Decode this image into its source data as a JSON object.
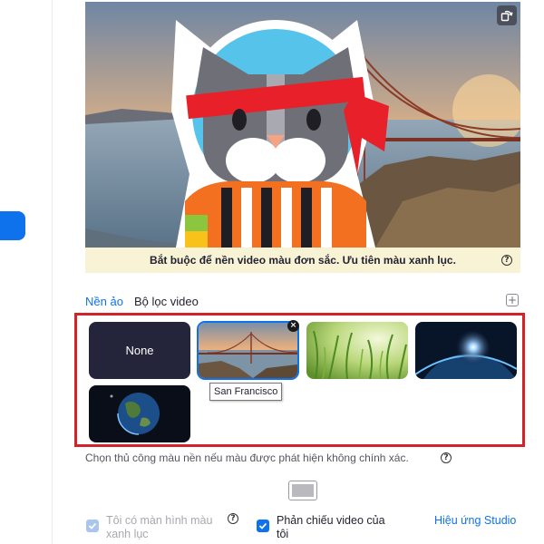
{
  "preview": {
    "notice": "Bắt buộc để nền video màu đơn sắc. Ưu tiên màu xanh lục."
  },
  "tabs": [
    {
      "label": "Nền ảo",
      "active": true
    },
    {
      "label": "Bộ lọc video",
      "active": false
    }
  ],
  "backgrounds": [
    {
      "label": "None"
    },
    {
      "tooltip": "San Francisco",
      "selected": true
    },
    {
      "name": "grass"
    },
    {
      "name": "earth-space"
    },
    {
      "name": "earth"
    }
  ],
  "manual_color": {
    "text": "Chọn thủ công màu nền nếu màu được phát hiện không chính xác."
  },
  "options": {
    "green_screen_label": "Tôi có màn hình màu xanh lục",
    "green_screen_checked": true,
    "green_screen_disabled": true,
    "mirror_label": "Phản chiếu video của tôi",
    "mirror_checked": true,
    "studio_effects_link": "Hiệu ứng Studio"
  },
  "colors": {
    "accent": "#0e72ed",
    "highlight_frame": "#d2232a",
    "notice_bg": "#f9f3d5"
  }
}
